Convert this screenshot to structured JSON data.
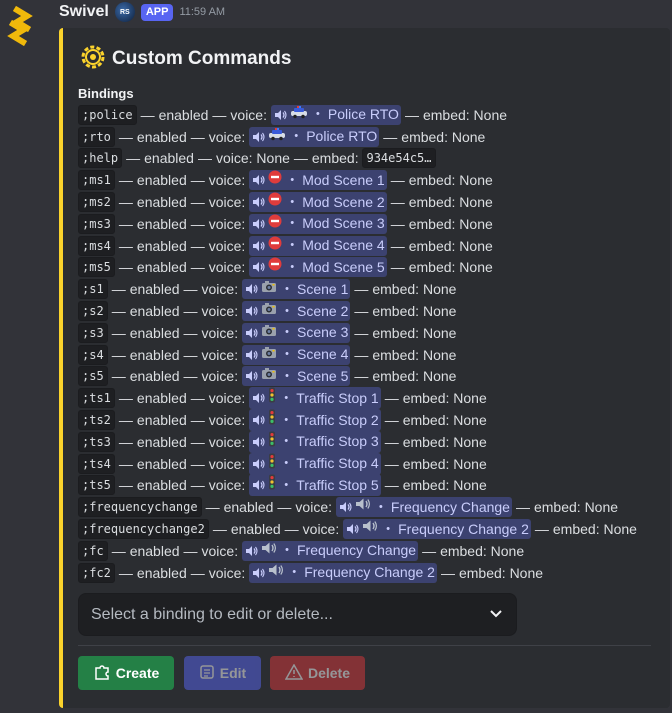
{
  "message": {
    "username": "Swivel",
    "badge_text": "RS",
    "app_tag": "APP",
    "timestamp": "11:59 AM"
  },
  "embed": {
    "accent_color": "#fbd32c",
    "title": "Custom Commands",
    "field_name": "Bindings",
    "bindings": [
      {
        "cmd": ";police",
        "status": "enabled",
        "voice": {
          "emoji": "police-car",
          "name": "Police RTO"
        },
        "embed": "None"
      },
      {
        "cmd": ";rto",
        "status": "enabled",
        "voice": {
          "emoji": "police-car",
          "name": "Police RTO"
        },
        "embed": "None"
      },
      {
        "cmd": ";help",
        "status": "enabled",
        "voice_none": "None",
        "embed_code": "934e54c5…"
      },
      {
        "cmd": ";ms1",
        "status": "enabled",
        "voice": {
          "emoji": "no-entry",
          "name": "Mod Scene 1"
        },
        "embed": "None"
      },
      {
        "cmd": ";ms2",
        "status": "enabled",
        "voice": {
          "emoji": "no-entry",
          "name": "Mod Scene 2"
        },
        "embed": "None"
      },
      {
        "cmd": ";ms3",
        "status": "enabled",
        "voice": {
          "emoji": "no-entry",
          "name": "Mod Scene 3"
        },
        "embed": "None"
      },
      {
        "cmd": ";ms4",
        "status": "enabled",
        "voice": {
          "emoji": "no-entry",
          "name": "Mod Scene 4"
        },
        "embed": "None"
      },
      {
        "cmd": ";ms5",
        "status": "enabled",
        "voice": {
          "emoji": "no-entry",
          "name": "Mod Scene 5"
        },
        "embed": "None"
      },
      {
        "cmd": ";s1",
        "status": "enabled",
        "voice": {
          "emoji": "camera",
          "name": "Scene 1"
        },
        "embed": "None"
      },
      {
        "cmd": ";s2",
        "status": "enabled",
        "voice": {
          "emoji": "camera",
          "name": "Scene 2"
        },
        "embed": "None"
      },
      {
        "cmd": ";s3",
        "status": "enabled",
        "voice": {
          "emoji": "camera",
          "name": "Scene 3"
        },
        "embed": "None"
      },
      {
        "cmd": ";s4",
        "status": "enabled",
        "voice": {
          "emoji": "camera",
          "name": "Scene 4"
        },
        "embed": "None"
      },
      {
        "cmd": ";s5",
        "status": "enabled",
        "voice": {
          "emoji": "camera",
          "name": "Scene 5"
        },
        "embed": "None"
      },
      {
        "cmd": ";ts1",
        "status": "enabled",
        "voice": {
          "emoji": "traffic-light",
          "name": "Traffic Stop 1"
        },
        "embed": "None"
      },
      {
        "cmd": ";ts2",
        "status": "enabled",
        "voice": {
          "emoji": "traffic-light",
          "name": "Traffic Stop 2"
        },
        "embed": "None"
      },
      {
        "cmd": ";ts3",
        "status": "enabled",
        "voice": {
          "emoji": "traffic-light",
          "name": "Traffic Stop 3"
        },
        "embed": "None"
      },
      {
        "cmd": ";ts4",
        "status": "enabled",
        "voice": {
          "emoji": "traffic-light",
          "name": "Traffic Stop 4"
        },
        "embed": "None"
      },
      {
        "cmd": ";ts5",
        "status": "enabled",
        "voice": {
          "emoji": "traffic-light",
          "name": "Traffic Stop 5"
        },
        "embed": "None"
      },
      {
        "cmd": ";frequencychange",
        "status": "enabled",
        "voice": {
          "emoji": "speaker",
          "name": "Frequency Change"
        },
        "embed": "None"
      },
      {
        "cmd": ";frequencychange2",
        "status": "enabled",
        "voice": {
          "emoji": "speaker",
          "name": "Frequency Change 2"
        },
        "embed": "None"
      },
      {
        "cmd": ";fc",
        "status": "enabled",
        "voice": {
          "emoji": "speaker",
          "name": "Frequency Change"
        },
        "embed": "None"
      },
      {
        "cmd": ";fc2",
        "status": "enabled",
        "voice": {
          "emoji": "speaker",
          "name": "Frequency Change 2"
        },
        "embed": "None"
      }
    ],
    "labels": {
      "sep": "—",
      "voice_label": "voice:",
      "embed_label": "embed:",
      "chan_dot": "・"
    },
    "select_placeholder": "Select a binding to edit or delete...",
    "buttons": {
      "create": "Create",
      "edit": "Edit",
      "delete": "Delete"
    }
  }
}
